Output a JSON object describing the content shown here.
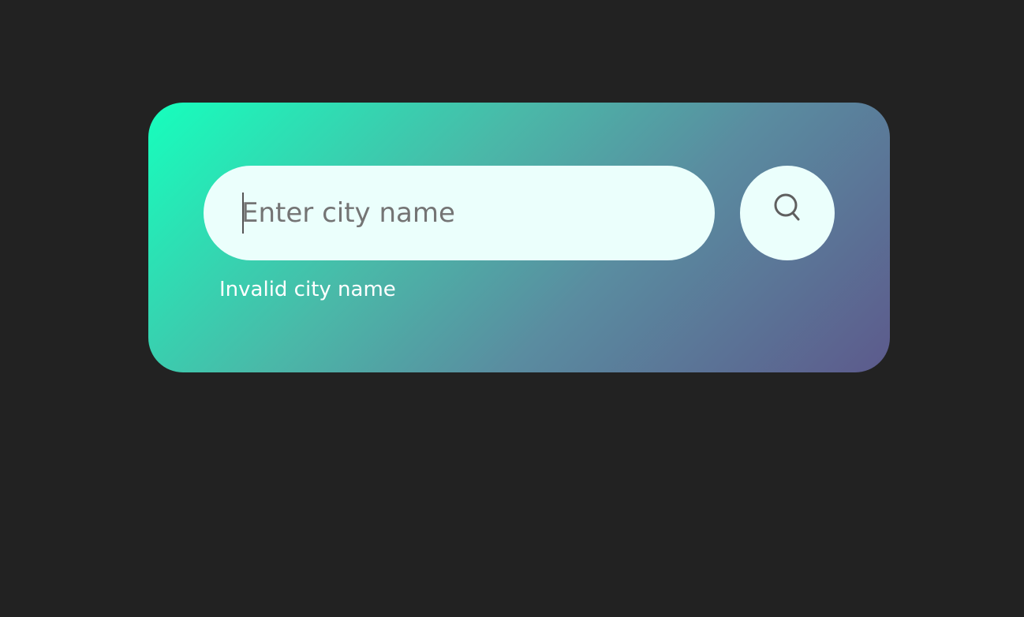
{
  "search": {
    "value": "",
    "placeholder": "Enter city name",
    "error_message": "Invalid city name"
  },
  "icons": {
    "search_button": "search-icon"
  },
  "colors": {
    "page_background": "#222222",
    "gradient_start": "#16ffbd",
    "gradient_end": "#5c5a8c",
    "field_background": "#ebfffc",
    "placeholder_text": "#747474",
    "error_text": "#ffffff"
  }
}
